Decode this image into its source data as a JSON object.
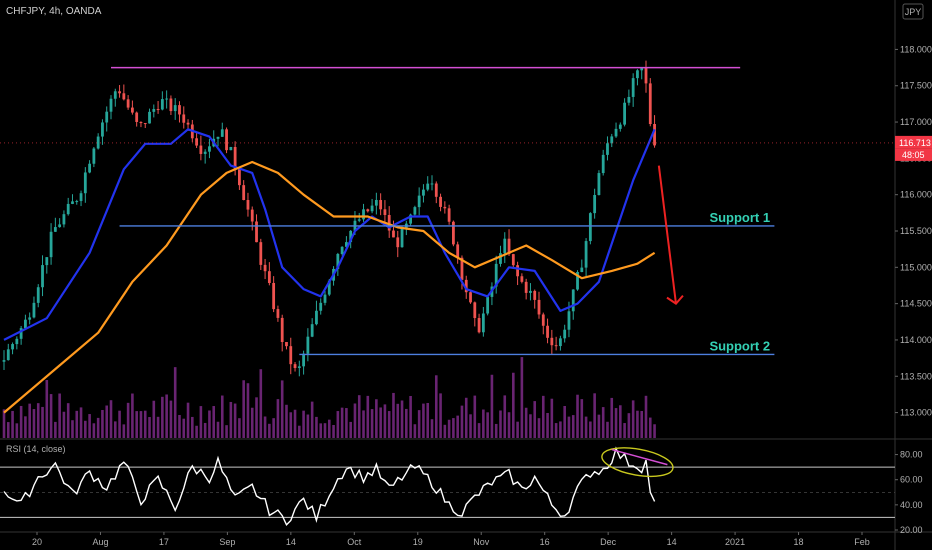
{
  "header": {
    "symbol": "CHFJPY, 4h, OANDA",
    "currency_button": "JPY"
  },
  "chart_data": [
    {
      "type": "candlestick",
      "title": "CHFJPY, 4h, OANDA",
      "currency": "JPY",
      "ylim": [
        112.65,
        118.35
      ],
      "y_ticks": [
        {
          "label": "118.000",
          "value": 118.0
        },
        {
          "label": "117.500",
          "value": 117.5
        },
        {
          "label": "117.000",
          "value": 117.0
        },
        {
          "label": "116.500",
          "value": 116.5
        },
        {
          "label": "116.000",
          "value": 116.0
        },
        {
          "label": "115.500",
          "value": 115.5
        },
        {
          "label": "115.000",
          "value": 115.0
        },
        {
          "label": "114.500",
          "value": 114.5
        },
        {
          "label": "114.000",
          "value": 114.0
        },
        {
          "label": "113.500",
          "value": 113.5
        },
        {
          "label": "113.000",
          "value": 113.0
        }
      ],
      "x_ticks": [
        "20",
        "Aug",
        "17",
        "Sep",
        "14",
        "Oct",
        "19",
        "Nov",
        "16",
        "Dec",
        "14",
        "2021",
        "18",
        "Feb"
      ],
      "price_path": [
        [
          0,
          113.7
        ],
        [
          6,
          114.3
        ],
        [
          12,
          115.5
        ],
        [
          18,
          116.0
        ],
        [
          22,
          116.8
        ],
        [
          27,
          117.5
        ],
        [
          32,
          116.9
        ],
        [
          37,
          117.3
        ],
        [
          42,
          117.1
        ],
        [
          47,
          116.6
        ],
        [
          51,
          116.9
        ],
        [
          54,
          116.5
        ],
        [
          57,
          115.9
        ],
        [
          60,
          115.2
        ],
        [
          63,
          114.6
        ],
        [
          66,
          113.9
        ],
        [
          69,
          113.5
        ],
        [
          72,
          114.1
        ],
        [
          75,
          114.6
        ],
        [
          79,
          115.3
        ],
        [
          84,
          115.7
        ],
        [
          88,
          115.9
        ],
        [
          92,
          115.3
        ],
        [
          96,
          115.7
        ],
        [
          100,
          116.3
        ],
        [
          105,
          115.5
        ],
        [
          108,
          114.8
        ],
        [
          111,
          114.1
        ],
        [
          114,
          114.6
        ],
        [
          117,
          115.4
        ],
        [
          120,
          114.9
        ],
        [
          124,
          114.6
        ],
        [
          127,
          114.1
        ],
        [
          130,
          113.9
        ],
        [
          133,
          114.5
        ],
        [
          136,
          115.2
        ],
        [
          139,
          116.2
        ],
        [
          142,
          116.8
        ],
        [
          145,
          117.1
        ],
        [
          148,
          117.6
        ],
        [
          150,
          117.75
        ],
        [
          152,
          116.75
        ]
      ],
      "current_price": "116.713",
      "countdown": "48:05",
      "current_price_color": "#f23645",
      "series": [
        {
          "name": "",
          "color": "#2233ee",
          "type": "moving-average",
          "points": [
            [
              0,
              114.0
            ],
            [
              10,
              114.3
            ],
            [
              20,
              115.2
            ],
            [
              28,
              116.35
            ],
            [
              33,
              116.7
            ],
            [
              39,
              116.7
            ],
            [
              43,
              116.9
            ],
            [
              48,
              116.8
            ],
            [
              53,
              116.4
            ],
            [
              58,
              116.3
            ],
            [
              61,
              115.8
            ],
            [
              65,
              115.0
            ],
            [
              70,
              114.7
            ],
            [
              74,
              114.6
            ],
            [
              78,
              115.0
            ],
            [
              82,
              115.5
            ],
            [
              86,
              115.7
            ],
            [
              90,
              115.55
            ],
            [
              95,
              115.7
            ],
            [
              99,
              115.7
            ],
            [
              103,
              115.2
            ],
            [
              108,
              114.7
            ],
            [
              113,
              114.6
            ],
            [
              118,
              115.0
            ],
            [
              124,
              114.95
            ],
            [
              130,
              114.4
            ],
            [
              134,
              114.5
            ],
            [
              139,
              114.8
            ],
            [
              143,
              115.5
            ],
            [
              147,
              116.2
            ],
            [
              152,
              116.9
            ]
          ]
        },
        {
          "name": "",
          "color": "#ff9a1f",
          "type": "moving-average",
          "points": [
            [
              0,
              113.0
            ],
            [
              12,
              113.6
            ],
            [
              22,
              114.1
            ],
            [
              30,
              114.8
            ],
            [
              38,
              115.3
            ],
            [
              46,
              116.0
            ],
            [
              52,
              116.3
            ],
            [
              58,
              116.45
            ],
            [
              64,
              116.3
            ],
            [
              70,
              116.0
            ],
            [
              77,
              115.7
            ],
            [
              85,
              115.7
            ],
            [
              92,
              115.55
            ],
            [
              98,
              115.5
            ],
            [
              104,
              115.2
            ],
            [
              110,
              115.0
            ],
            [
              116,
              115.15
            ],
            [
              122,
              115.3
            ],
            [
              128,
              115.1
            ],
            [
              135,
              114.85
            ],
            [
              142,
              114.95
            ],
            [
              148,
              115.05
            ],
            [
              152,
              115.2
            ]
          ]
        }
      ],
      "resistance": {
        "value": 117.75,
        "color": "#d44fd4"
      },
      "supports": [
        {
          "label": "Support 1",
          "value": 115.57,
          "color": "#4d7fe0",
          "label_color": "#34d0b4"
        },
        {
          "label": "Support 2",
          "value": 113.8,
          "color": "#4d7fe0",
          "label_color": "#34d0b4"
        }
      ],
      "forecast_arrow": {
        "color": "#ee2222",
        "from": [
          153,
          116.4
        ],
        "to": [
          157,
          114.5
        ]
      },
      "volume_color": "#7b2a86"
    },
    {
      "type": "line",
      "title": "RSI (14, close)",
      "ylim": [
        20,
        90
      ],
      "y_ticks": [
        {
          "label": "80.00",
          "value": 80
        },
        {
          "label": "60.00",
          "value": 60
        },
        {
          "label": "40.00",
          "value": 40
        },
        {
          "label": "20.00",
          "value": 20
        }
      ],
      "overbought": 70,
      "oversold": 30,
      "series": [
        {
          "name": "",
          "color": "#ffffff",
          "points": [
            [
              0,
              52
            ],
            [
              4,
              40
            ],
            [
              8,
              62
            ],
            [
              12,
              72
            ],
            [
              16,
              48
            ],
            [
              20,
              66
            ],
            [
              24,
              54
            ],
            [
              28,
              74
            ],
            [
              32,
              44
            ],
            [
              36,
              60
            ],
            [
              40,
              38
            ],
            [
              44,
              70
            ],
            [
              48,
              62
            ],
            [
              50,
              74
            ],
            [
              54,
              44
            ],
            [
              58,
              54
            ],
            [
              62,
              36
            ],
            [
              66,
              28
            ],
            [
              70,
              44
            ],
            [
              73,
              30
            ],
            [
              77,
              56
            ],
            [
              80,
              70
            ],
            [
              84,
              62
            ],
            [
              87,
              68
            ],
            [
              90,
              52
            ],
            [
              93,
              62
            ],
            [
              96,
              70
            ],
            [
              100,
              58
            ],
            [
              104,
              40
            ],
            [
              107,
              34
            ],
            [
              110,
              46
            ],
            [
              114,
              58
            ],
            [
              118,
              64
            ],
            [
              121,
              52
            ],
            [
              124,
              62
            ],
            [
              128,
              40
            ],
            [
              131,
              32
            ],
            [
              134,
              52
            ],
            [
              137,
              66
            ],
            [
              140,
              68
            ],
            [
              143,
              82
            ],
            [
              146,
              74
            ],
            [
              149,
              70
            ],
            [
              150,
              74
            ],
            [
              151,
              52
            ],
            [
              152,
              40
            ]
          ]
        }
      ],
      "divergence": {
        "color": "#d44fd4",
        "highlight_color": "#c8c81e"
      }
    }
  ]
}
